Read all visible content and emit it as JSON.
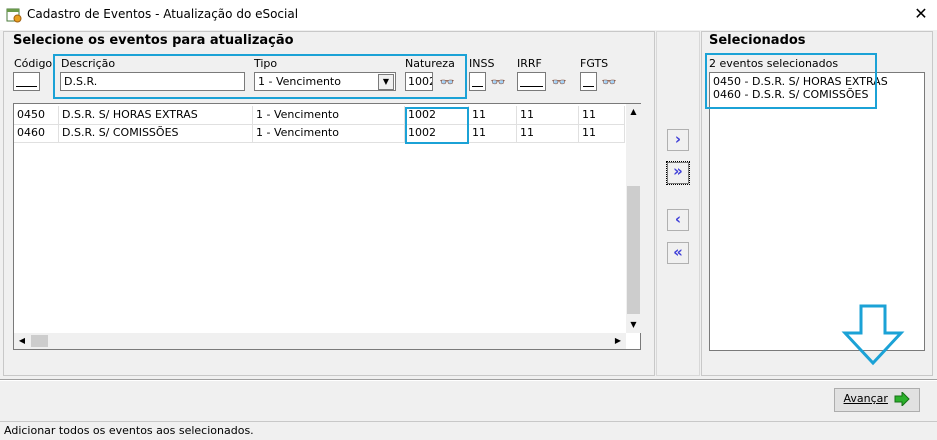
{
  "window": {
    "title": "Cadastro de Eventos - Atualização do eSocial",
    "close_glyph": "✕",
    "app_icon": "calendar-check-icon"
  },
  "left_panel": {
    "title": "Selecione os eventos para atualização",
    "filters": {
      "codigo_label": "Código",
      "descricao_label": "Descrição",
      "descricao_value": "D.S.R.",
      "tipo_label": "Tipo",
      "tipo_value": "1 - Vencimento",
      "natureza_label": "Natureza",
      "natureza_value": "1002",
      "inss_label": "INSS",
      "irrf_label": "IRRF",
      "fgts_label": "FGTS"
    },
    "rows": [
      {
        "codigo": "0450",
        "descricao": "D.S.R. S/ HORAS EXTRAS",
        "tipo": "1 - Vencimento",
        "natureza": "1002",
        "inss": "11",
        "irrf": "11",
        "fgts": "11"
      },
      {
        "codigo": "0460",
        "descricao": "D.S.R. S/ COMISSÕES",
        "tipo": "1 - Vencimento",
        "natureza": "1002",
        "inss": "11",
        "irrf": "11",
        "fgts": "11"
      }
    ]
  },
  "transfer_buttons": {
    "add_one": "›",
    "add_all": "»",
    "remove_one": "‹",
    "remove_all": "«"
  },
  "right_panel": {
    "title": "Selecionados",
    "count_text": "2 eventos selecionados",
    "items": [
      "0450 - D.S.R. S/ HORAS EXTRAS",
      "0460 - D.S.R. S/ COMISSÕES"
    ]
  },
  "footer": {
    "next_label": "Avançar"
  },
  "status": {
    "text": "Adicionar todos os eventos aos selecionados."
  },
  "colors": {
    "highlight": "#1ba2d6",
    "nav_arrow": "#3f3fd8",
    "next_arrow": "#2bb02b"
  }
}
